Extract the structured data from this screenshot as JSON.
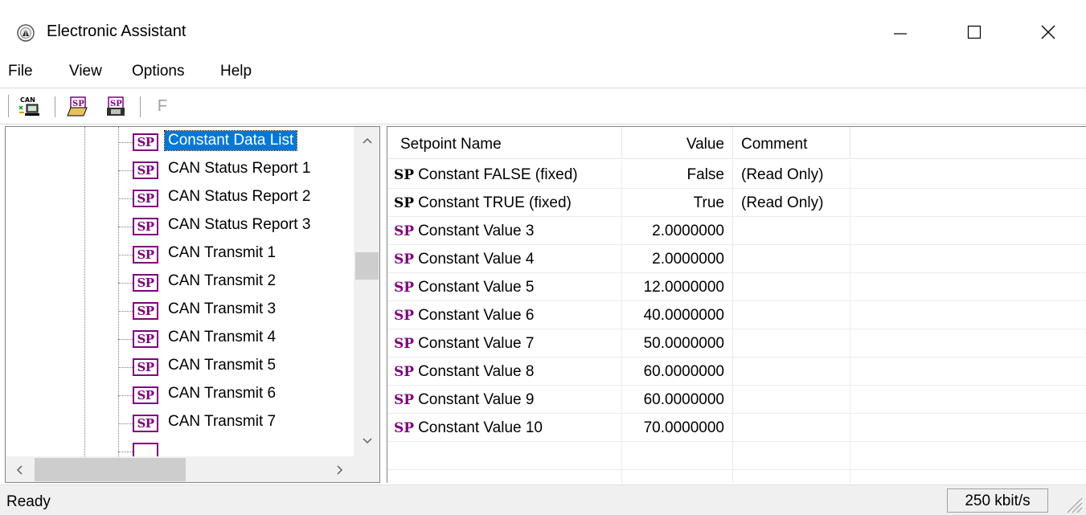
{
  "window": {
    "title": "Electronic Assistant",
    "minimize_label": "Minimize",
    "maximize_label": "Maximize",
    "close_label": "Close"
  },
  "menu": {
    "items": [
      {
        "label": "File"
      },
      {
        "label": "View"
      },
      {
        "label": "Options"
      },
      {
        "label": "Help"
      }
    ]
  },
  "toolbar": {
    "buttons": [
      {
        "icon": "can-connect-icon",
        "label": "CAN"
      },
      {
        "icon": "sp-open-icon",
        "label": "SP"
      },
      {
        "icon": "sp-save-icon",
        "label": "SP"
      },
      {
        "icon": "f-icon",
        "label": "F"
      }
    ]
  },
  "tree": {
    "icon_text": "SP",
    "selected_index": 0,
    "items": [
      {
        "label": "Constant Data List"
      },
      {
        "label": "CAN Status Report 1"
      },
      {
        "label": "CAN Status Report 2"
      },
      {
        "label": "CAN Status Report 3"
      },
      {
        "label": "CAN Transmit 1"
      },
      {
        "label": "CAN Transmit 2"
      },
      {
        "label": "CAN Transmit 3"
      },
      {
        "label": "CAN Transmit 4"
      },
      {
        "label": "CAN Transmit 5"
      },
      {
        "label": "CAN Transmit 6"
      },
      {
        "label": "CAN Transmit 7"
      }
    ]
  },
  "list": {
    "columns": {
      "name": "Setpoint Name",
      "value": "Value",
      "comment": "Comment"
    },
    "prefix": "SP",
    "rows": [
      {
        "name": "Constant FALSE (fixed)",
        "value": "False",
        "comment": "(Read Only)",
        "prefix_color": "#000000"
      },
      {
        "name": "Constant TRUE (fixed)",
        "value": "True",
        "comment": "(Read Only)",
        "prefix_color": "#000000"
      },
      {
        "name": "Constant Value 3",
        "value": "2.0000000",
        "comment": "",
        "prefix_color": "#800080"
      },
      {
        "name": "Constant Value 4",
        "value": "2.0000000",
        "comment": "",
        "prefix_color": "#800080"
      },
      {
        "name": "Constant Value 5",
        "value": "12.0000000",
        "comment": "",
        "prefix_color": "#800080"
      },
      {
        "name": "Constant Value 6",
        "value": "40.0000000",
        "comment": "",
        "prefix_color": "#800080"
      },
      {
        "name": "Constant Value 7",
        "value": "50.0000000",
        "comment": "",
        "prefix_color": "#800080"
      },
      {
        "name": "Constant Value 8",
        "value": "60.0000000",
        "comment": "",
        "prefix_color": "#800080"
      },
      {
        "name": "Constant Value 9",
        "value": "60.0000000",
        "comment": "",
        "prefix_color": "#800080"
      },
      {
        "name": "Constant Value 10",
        "value": "70.0000000",
        "comment": "",
        "prefix_color": "#800080"
      }
    ]
  },
  "status": {
    "text": "Ready",
    "bitrate": "250 kbit/s"
  },
  "colors": {
    "selection": "#0078d7",
    "sp_icon": "#800080"
  }
}
